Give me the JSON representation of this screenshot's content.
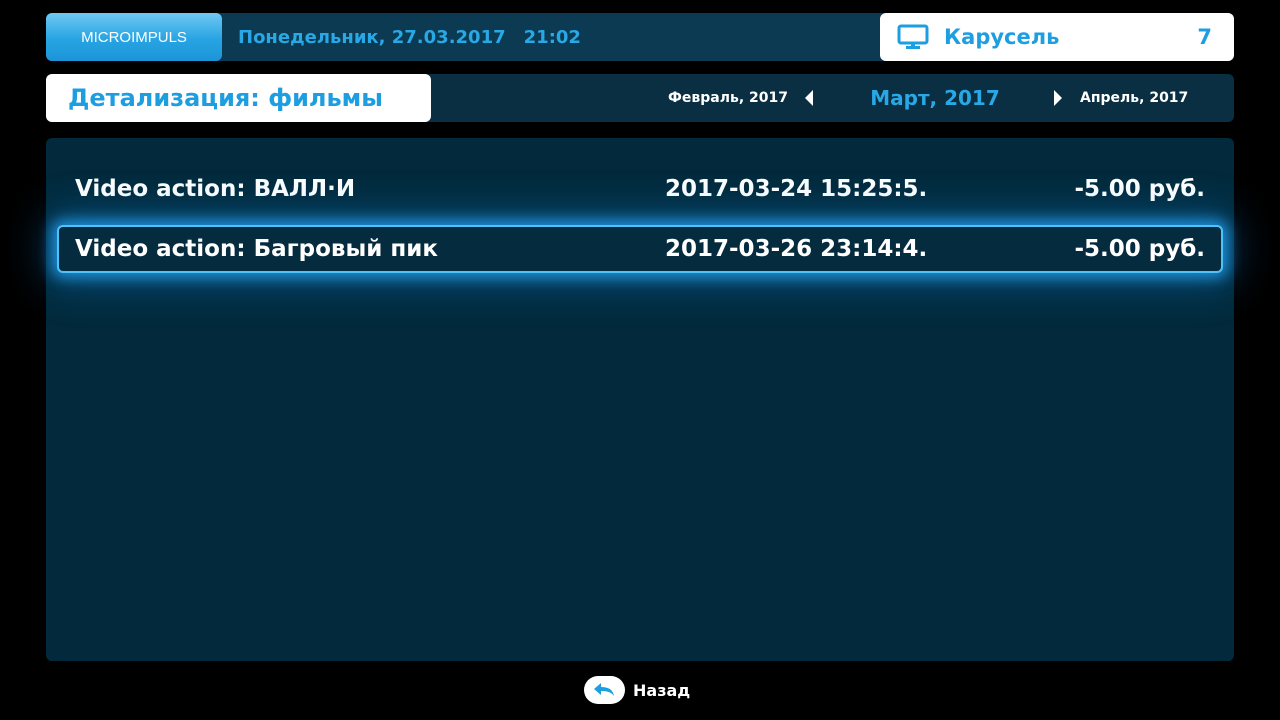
{
  "header": {
    "logo_text": "MICROIMPULS",
    "date": "Понедельник, 27.03.2017",
    "time": "21:02",
    "channel": {
      "icon": "tv-icon",
      "name": "Карусель",
      "number": "7"
    }
  },
  "subheader": {
    "title": "Детализация: фильмы",
    "prev_month": "Февраль, 2017",
    "current_month": "Март, 2017",
    "next_month": "Апрель, 2017"
  },
  "rows": [
    {
      "title": "Video action: ВАЛЛ·И",
      "datetime": "2017-03-24 15:25:5.",
      "price": "-5.00 руб."
    },
    {
      "title": "Video action: Багровый пик",
      "datetime": "2017-03-26 23:14:4.",
      "price": "-5.00 руб."
    }
  ],
  "footer": {
    "back_label": "Назад",
    "back_icon": "return-arrow-icon"
  },
  "colors": {
    "accent": "#1d9ee0",
    "panel": "#022a3c",
    "topbar": "#0b3a52",
    "highlight_glow": "#4fc3f7"
  }
}
